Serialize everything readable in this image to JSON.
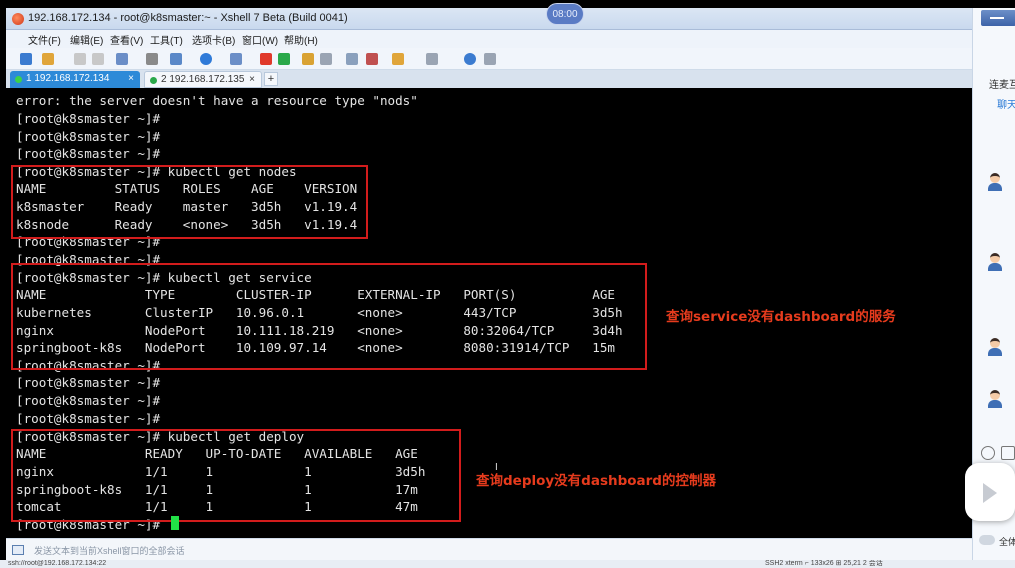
{
  "timer": "08:00",
  "window": {
    "title": "192.168.172.134 - root@k8smaster:~ - Xshell 7 Beta (Build 0041)"
  },
  "menu": [
    "文件(F)",
    "编辑(E)",
    "查看(V)",
    "工具(T)",
    "选项卡(B)",
    "窗口(W)",
    "帮助(H)"
  ],
  "tabs": {
    "active": {
      "label": "1 192.168.172.134",
      "close": "×"
    },
    "inactive": {
      "label": "2 192.168.172.135",
      "close": "×"
    },
    "add": "+"
  },
  "terminal": {
    "lines": [
      "error: the server doesn't have a resource type \"nods\"",
      "[root@k8smaster ~]#",
      "[root@k8smaster ~]#",
      "[root@k8smaster ~]#",
      "[root@k8smaster ~]# kubectl get nodes",
      "NAME         STATUS   ROLES    AGE    VERSION",
      "k8smaster    Ready    master   3d5h   v1.19.4",
      "k8snode      Ready    <none>   3d5h   v1.19.4",
      "[root@k8smaster ~]#",
      "[root@k8smaster ~]#",
      "[root@k8smaster ~]# kubectl get service",
      "NAME             TYPE        CLUSTER-IP      EXTERNAL-IP   PORT(S)          AGE",
      "kubernetes       ClusterIP   10.96.0.1       <none>        443/TCP          3d5h",
      "nginx            NodePort    10.111.18.219   <none>        80:32064/TCP     3d4h",
      "springboot-k8s   NodePort    10.109.97.14    <none>        8080:31914/TCP   15m",
      "[root@k8smaster ~]#",
      "[root@k8smaster ~]#",
      "[root@k8smaster ~]#",
      "[root@k8smaster ~]#",
      "[root@k8smaster ~]# kubectl get deploy",
      "NAME             READY   UP-TO-DATE   AVAILABLE   AGE",
      "nginx            1/1     1            1           3d5h",
      "springboot-k8s   1/1     1            1           17m",
      "tomcat           1/1     1            1           47m",
      "[root@k8smaster ~]#"
    ],
    "annotation_service": "查询service没有dashboard的服务",
    "annotation_deploy": "查询deploy没有dashboard的控制器"
  },
  "sendbar": {
    "text": "发送文本到当前Xshell窗口的全部会话"
  },
  "statusbar": {
    "left": "ssh://root@192.168.172.134:22",
    "right": "SSH2   xterm   ⌐ 133x26   ⊞ 25,21   2 会话"
  },
  "rightpanel": {
    "contact_label": "连麦互",
    "chat_tab": "聊天",
    "all_label": "全体"
  },
  "colors": {
    "annotation": "#e63b1d",
    "highlight_box": "#d21c1c",
    "cursor": "#22e047",
    "active_tab": "#2d8ad8"
  }
}
